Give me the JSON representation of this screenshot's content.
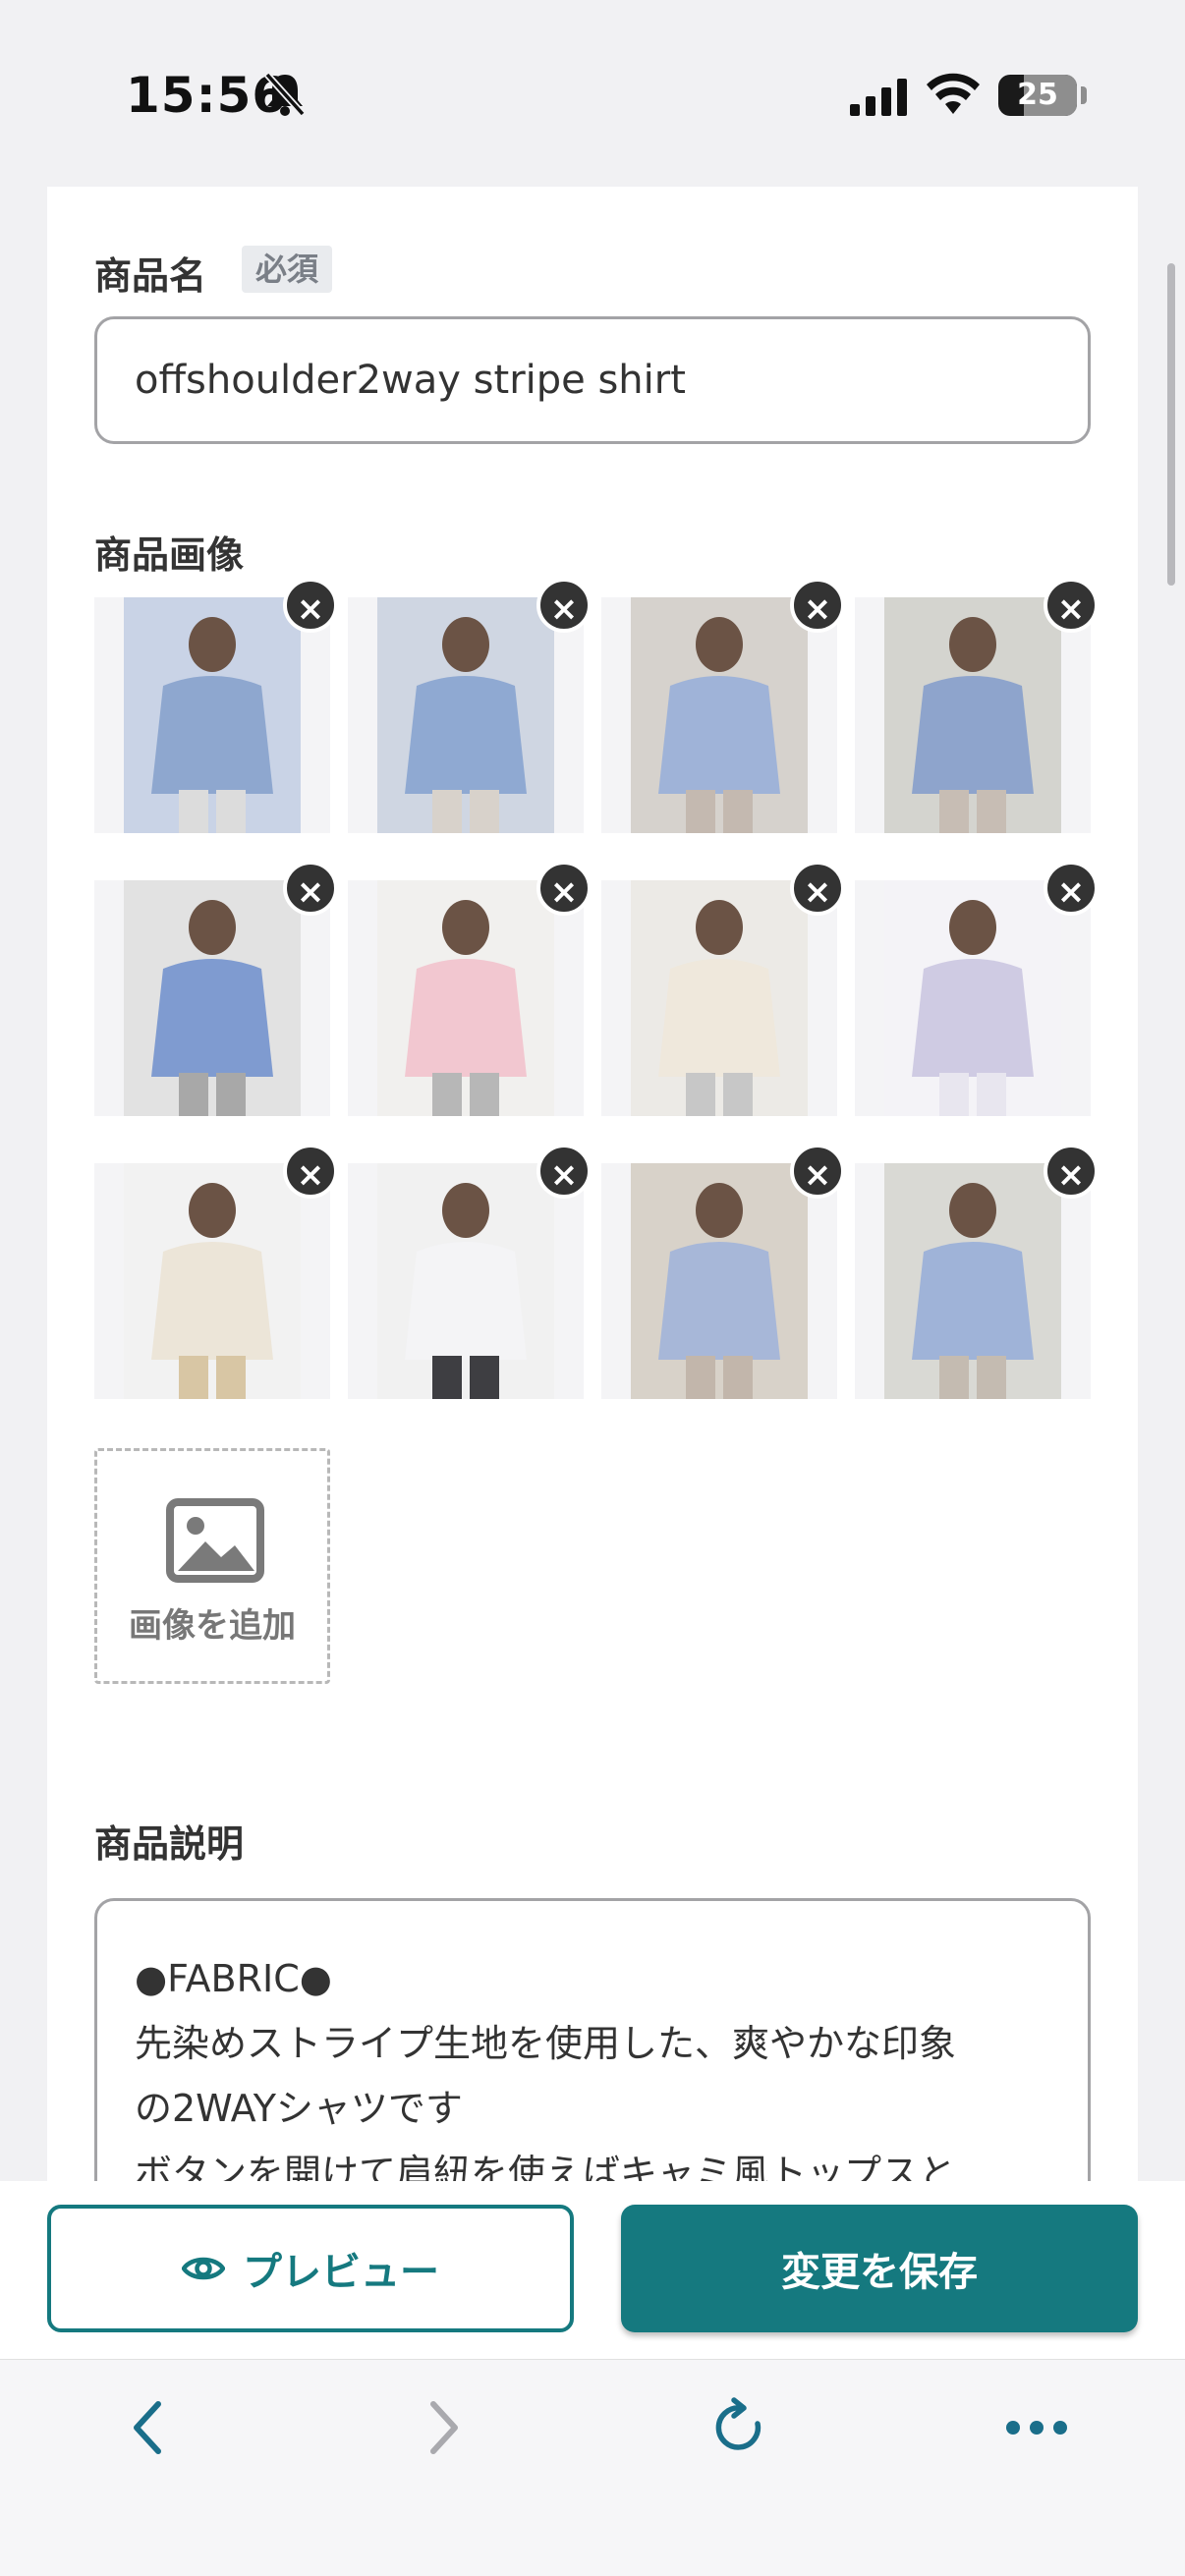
{
  "status_bar": {
    "time": "15:56",
    "battery": "25"
  },
  "form": {
    "product_name_label": "商品名",
    "required_badge": "必須",
    "product_name_value": "offshoulder2way stripe shirt",
    "product_images_label": "商品画像",
    "images": [
      {
        "alt": "collage of stripe shirt outfits",
        "remove": "×"
      },
      {
        "alt": "stripe shirt worn with camisole",
        "remove": "×"
      },
      {
        "alt": "mirror selfie in stripe shirt",
        "remove": "×"
      },
      {
        "alt": "side view stripe shirt",
        "remove": "×"
      },
      {
        "alt": "blue shirt and pink shirt",
        "remove": "×"
      },
      {
        "alt": "pink shirt",
        "remove": "×"
      },
      {
        "alt": "cream shirt",
        "remove": "×"
      },
      {
        "alt": "stripe fabric closeup",
        "remove": "×"
      },
      {
        "alt": "cream shirt with beige pants",
        "remove": "×"
      },
      {
        "alt": "white shirt back view",
        "remove": "×"
      },
      {
        "alt": "blue stripe shirt pose",
        "remove": "×"
      },
      {
        "alt": "blue shirt mirror selfie",
        "remove": "×"
      }
    ],
    "add_image_label": "画像を追加",
    "description_label": "商品説明",
    "description_lines": [
      "●FABRIC●",
      "先染めストライプ生地を使用した、爽やかな印象",
      "の2WAYシャツです",
      "ボタンを開けて肩紐を使えばキャミ風トップスと"
    ]
  },
  "actions": {
    "preview_label": "プレビュー",
    "save_label": "変更を保存"
  },
  "colors": {
    "accent": "#15797f",
    "remove_button": "#333333"
  },
  "browser_nav": [
    "back-icon",
    "forward-icon",
    "reload-icon",
    "more-icon"
  ]
}
